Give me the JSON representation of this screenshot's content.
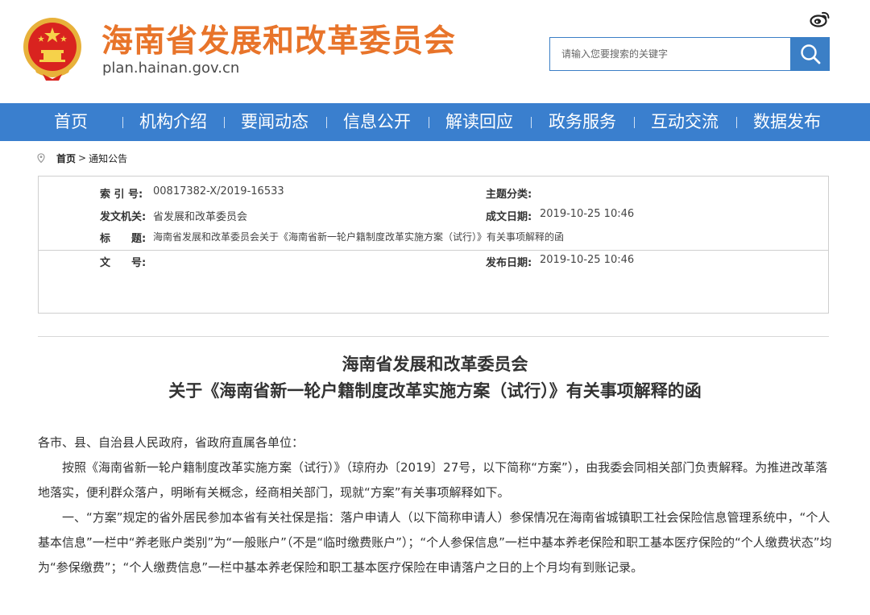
{
  "header": {
    "site_title": "海南省发展和改革委员会",
    "site_url": "plan.hainan.gov.cn",
    "search_placeholder": "请输入您要搜索的关键字"
  },
  "nav": {
    "items": [
      "首页",
      "机构介绍",
      "要闻动态",
      "信息公开",
      "解读回应",
      "政务服务",
      "互动交流",
      "数据发布"
    ]
  },
  "breadcrumb": {
    "home": "首页",
    "arrow": ">",
    "current": "通知公告"
  },
  "info": {
    "index_label": "索 引 号:",
    "index_value": "00817382-X/2019-16533",
    "topic_label": "主题分类:",
    "topic_value": "",
    "issuer_label": "发文机关:",
    "issuer_value": "省发展和改革委员会",
    "created_label": "成文日期:",
    "created_value": "2019-10-25 10:46",
    "title_label": "标　　题:",
    "title_value": "海南省发展和改革委员会关于《海南省新一轮户籍制度改革实施方案（试行）》有关事项解释的函",
    "docno_label": "文　　号:",
    "docno_value": "",
    "published_label": "发布日期:",
    "published_value": "2019-10-25 10:46"
  },
  "article": {
    "title_line1": "海南省发展和改革委员会",
    "title_line2": "关于《海南省新一轮户籍制度改革实施方案（试行）》有关事项解释的函",
    "salutation": "各市、县、自治县人民政府，省政府直属各单位：",
    "para1": "按照《海南省新一轮户籍制度改革实施方案（试行）》（琼府办〔2019〕27号，以下简称“方案”），由我委会同相关部门负责解释。为推进改革落地落实，便利群众落户，明晰有关概念，经商相关部门，现就“方案”有关事项解释如下。",
    "para2": "一、“方案”规定的省外居民参加本省有关社保是指：落户申请人（以下简称申请人）参保情况在海南省城镇职工社会保险信息管理系统中，“个人基本信息”一栏中“养老账户类别”为“一般账户”（不是“临时缴费账户”）；“个人参保信息”一栏中基本养老保险和职工基本医疗保险的“个人缴费状态”均为“参保缴费”；“个人缴费信息”一栏中基本养老保险和职工基本医疗保险在申请落户之日的上个月均有到账记录。"
  },
  "colors": {
    "nav_blue": "#3a7fce",
    "title_orange": "#e8742a"
  }
}
